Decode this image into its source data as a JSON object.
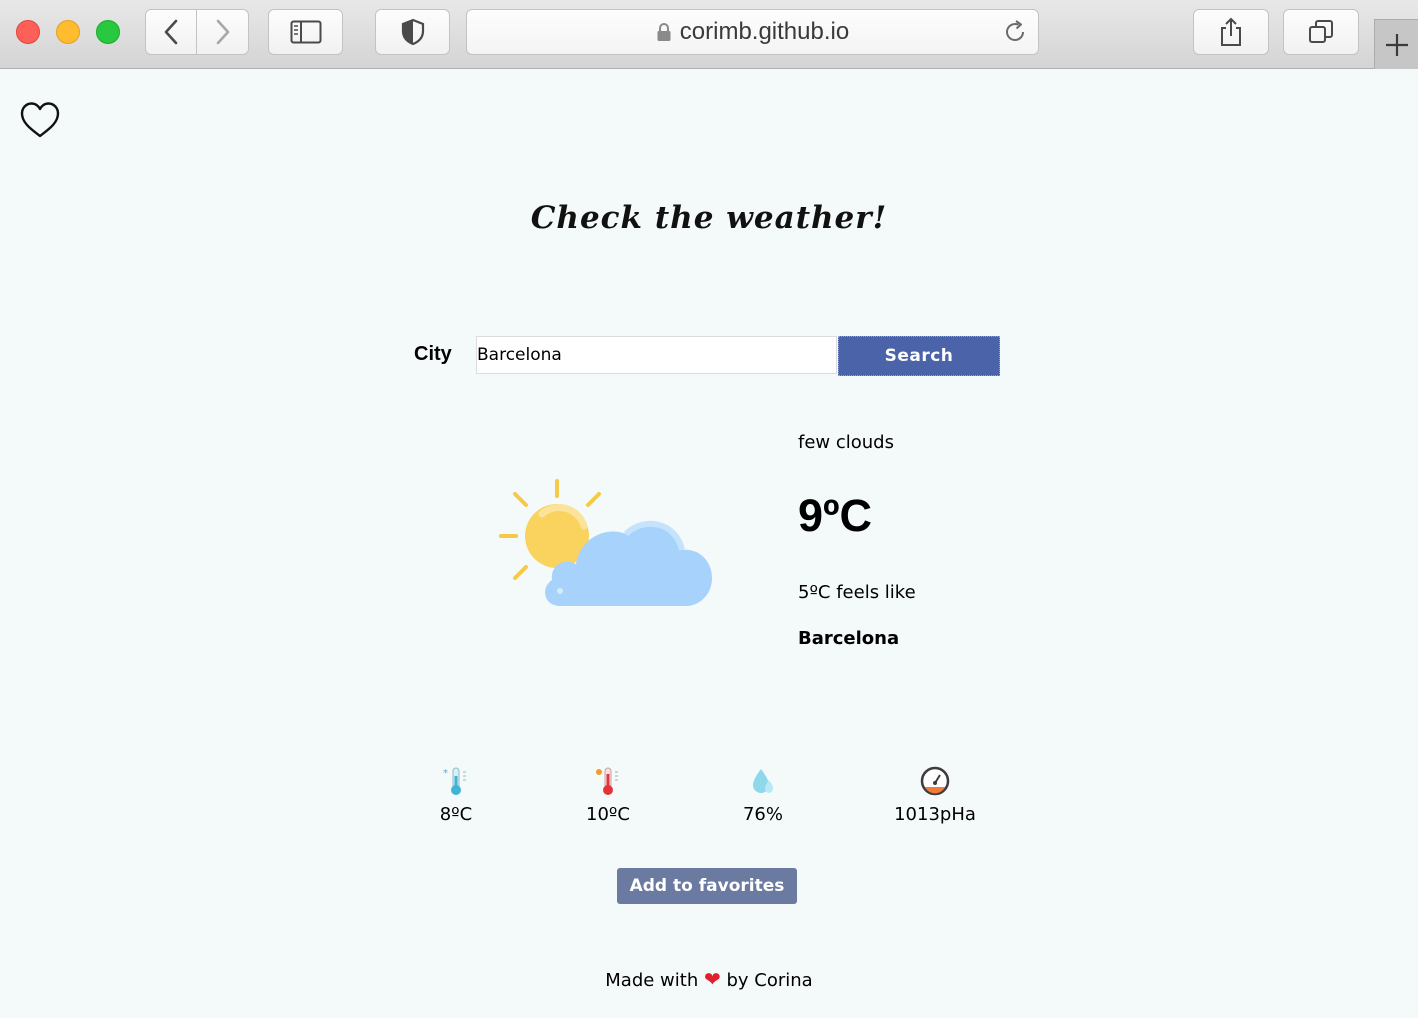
{
  "browser": {
    "url": "corimb.github.io"
  },
  "page": {
    "title": "Check the weather!",
    "city_label": "City",
    "city_value": "Barcelona",
    "search_label": "Search"
  },
  "weather": {
    "description": "few clouds",
    "temperature": "9ºC",
    "feels_like": "5ºC feels like",
    "city": "Barcelona",
    "icon": "sun-behind-cloud"
  },
  "stats": [
    {
      "icon": "thermometer-cold-icon",
      "value": "8ºC"
    },
    {
      "icon": "thermometer-hot-icon",
      "value": "10ºC"
    },
    {
      "icon": "humidity-drop-icon",
      "value": "76%"
    },
    {
      "icon": "pressure-gauge-icon",
      "value": "1013pHa"
    }
  ],
  "favorites_button": "Add to favorites",
  "footer": {
    "before": "Made with",
    "heart": "❤",
    "after": "by Corina"
  },
  "colors": {
    "background": "#f4faf9",
    "search_button": "#4b63a8",
    "favorites_button": "#6b7aa1",
    "footer_heart": "#e0202b"
  }
}
